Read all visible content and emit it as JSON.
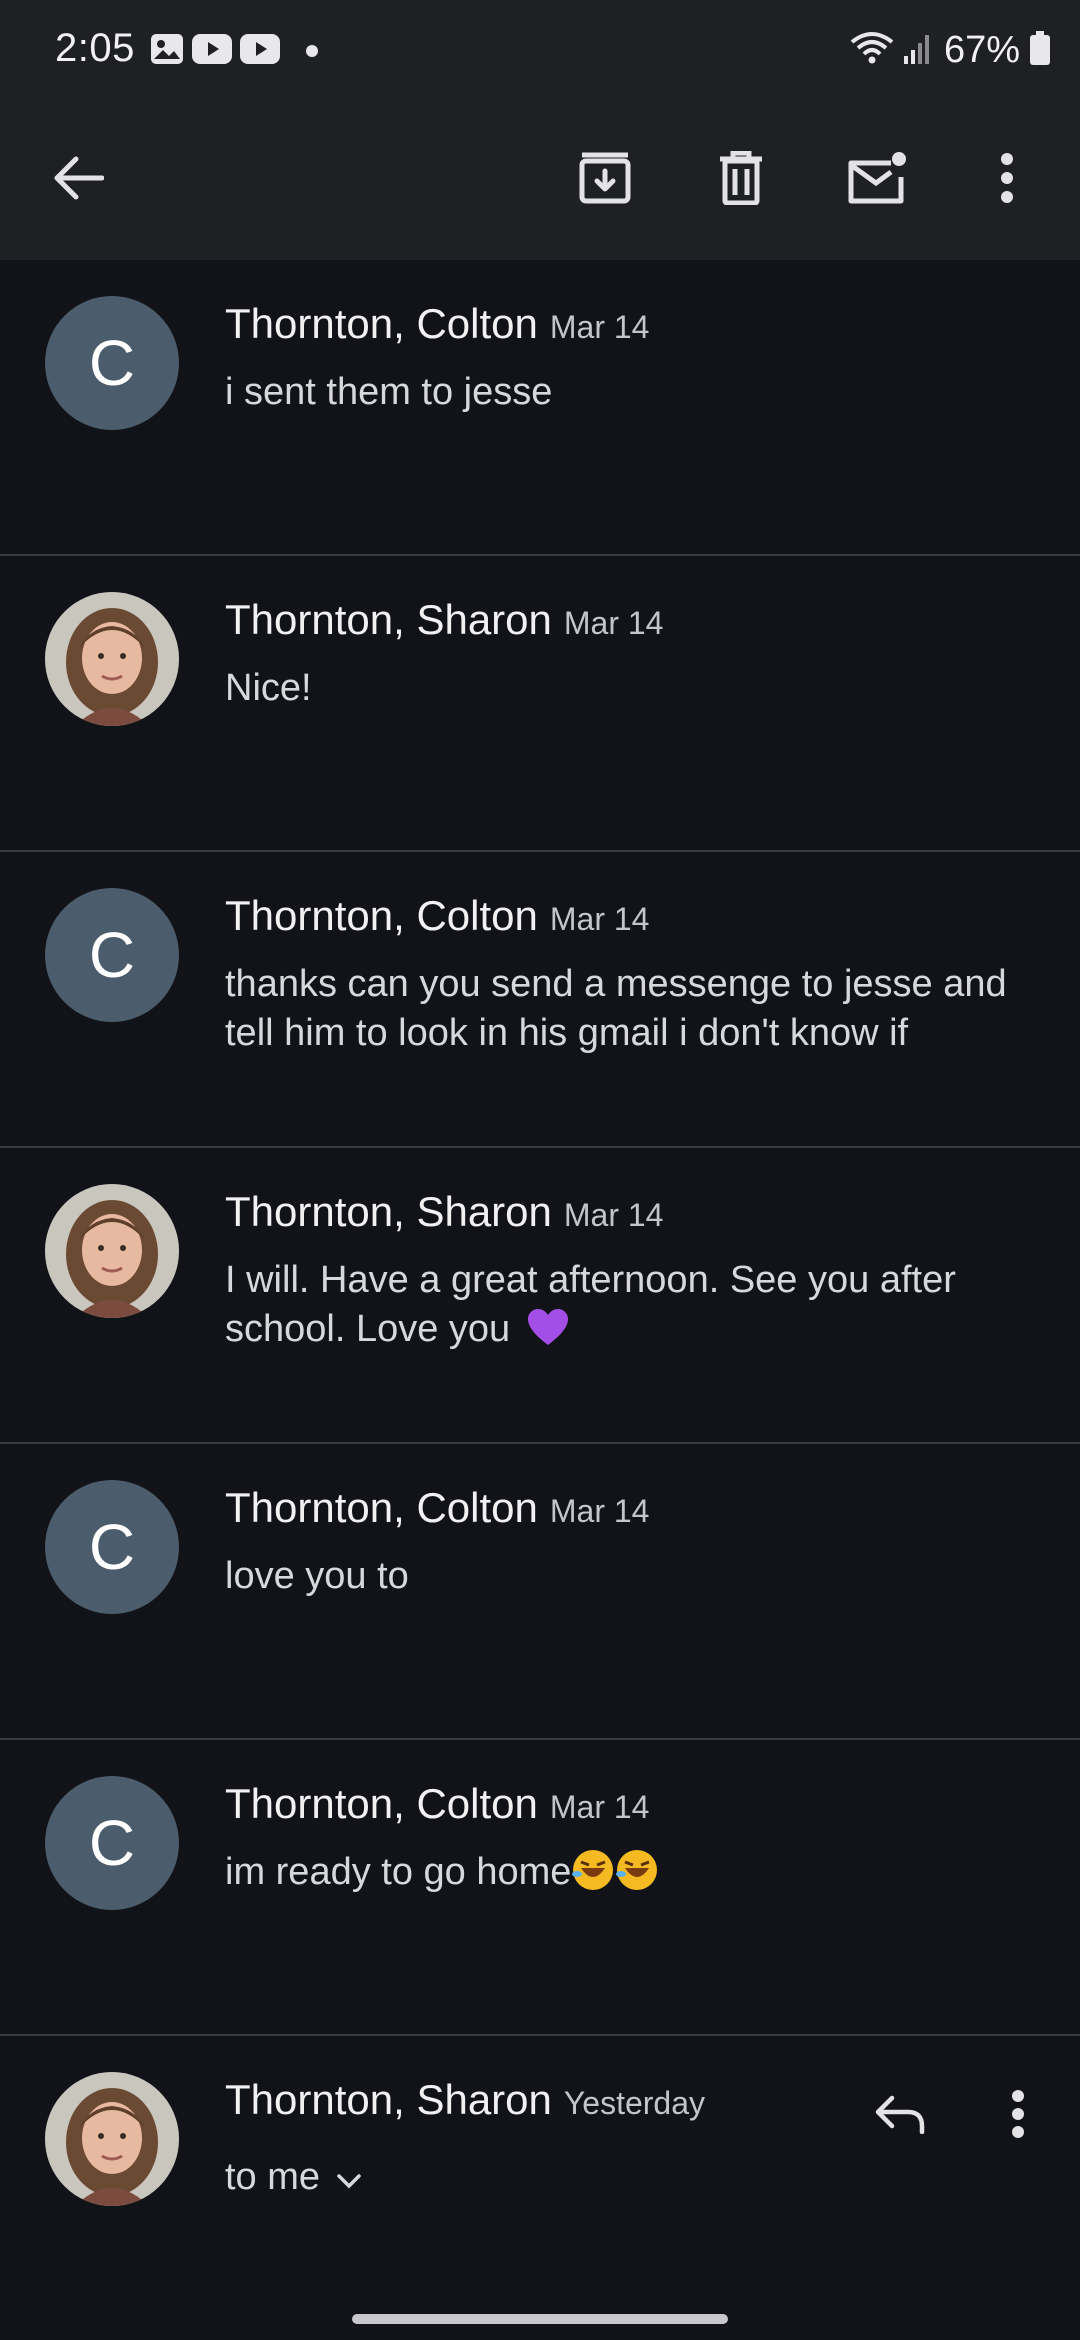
{
  "status_bar": {
    "time": "2:05",
    "battery": "67%",
    "icons_left": [
      "gallery-icon",
      "youtube-icon",
      "youtube-icon",
      "dot"
    ],
    "icons_right": [
      "wifi-icon",
      "signal-icon",
      "battery-icon"
    ]
  },
  "toolbar": {
    "back": "back-arrow-icon",
    "actions": [
      "archive-icon",
      "delete-icon",
      "mark-unread-icon",
      "more-vert-icon"
    ]
  },
  "messages": [
    {
      "sender": "Thornton, Colton",
      "date": "Mar 14",
      "snippet": "i sent them to jesse",
      "avatar": "C"
    },
    {
      "sender": "Thornton, Sharon",
      "date": "Mar 14",
      "snippet": "Nice!",
      "avatar": "photo"
    },
    {
      "sender": "Thornton, Colton",
      "date": "Mar 14",
      "snippet": "thanks can you send a messenge to jesse and tell him to look in his gmail i don't know if",
      "avatar": "C"
    },
    {
      "sender": "Thornton, Sharon",
      "date": "Mar 14",
      "snippet": "I will. Have a great afternoon. See you after school. Love you",
      "avatar": "photo",
      "emoji": "purple-heart"
    },
    {
      "sender": "Thornton, Colton",
      "date": "Mar 14",
      "snippet": "love you to",
      "avatar": "C"
    },
    {
      "sender": "Thornton, Colton",
      "date": "Mar 14",
      "snippet": "im ready to go home",
      "avatar": "C",
      "emoji": "rofl-x2"
    }
  ],
  "last_message": {
    "sender": "Thornton, Sharon",
    "date": "Yesterday",
    "recipient": "to me"
  },
  "colors": {
    "background": "#121318",
    "toolbar": "#1f2024",
    "avatar_letter_bg": "#4b5d6c",
    "divider": "#3a3b40"
  }
}
